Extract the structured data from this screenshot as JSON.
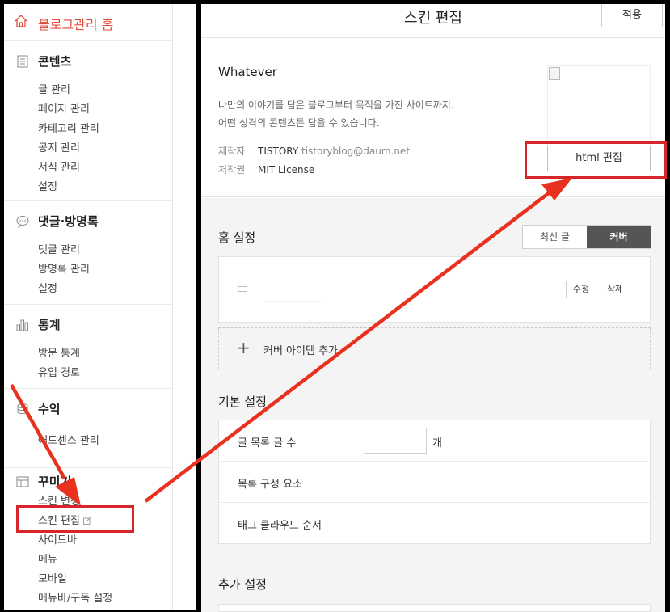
{
  "sidebar": {
    "home": "블로그관리 홈",
    "sections": [
      {
        "title": "콘텐츠",
        "icon": "document-icon",
        "items": [
          "글 관리",
          "페이지 관리",
          "카테고리 관리",
          "공지 관리",
          "서식 관리",
          "설정"
        ]
      },
      {
        "title": "댓글·방명록",
        "icon": "speech-bubble-icon",
        "items": [
          "댓글 관리",
          "방명록 관리",
          "설정"
        ]
      },
      {
        "title": "통계",
        "icon": "bar-chart-icon",
        "items": [
          "방문 통계",
          "유입 경로"
        ]
      },
      {
        "title": "수익",
        "icon": "coins-icon",
        "items": [
          "애드센스 관리"
        ]
      },
      {
        "title": "꾸미기",
        "icon": "layout-icon",
        "items": [
          "스킨 변경",
          "스킨 편집",
          "사이드바",
          "메뉴",
          "모바일",
          "메뉴바/구독 설정"
        ]
      }
    ]
  },
  "editor": {
    "title": "스킨 편집",
    "apply": "적용",
    "skin": {
      "name": "Whatever",
      "desc1": "나만의 이야기를 담은 블로그부터 목적을 가진 사이트까지.",
      "desc2": "어떤 성격의 콘텐츠든 담을 수 있습니다.",
      "author_label": "제작자",
      "author": "TISTORY",
      "email": "tistoryblog@daum.net",
      "license_label": "저작권",
      "license": "MIT License",
      "html_edit": "html 편집"
    },
    "home_settings": {
      "title": "홈 설정",
      "toggle": [
        "최신 글",
        "커버"
      ],
      "edit": "수정",
      "delete": "삭제",
      "add_cover": "커버 아이템 추가"
    },
    "basic_settings": {
      "title": "기본 설정",
      "rows": [
        "글 목록 글 수",
        "목록 구성 요소",
        "태그 클라우드 순서"
      ],
      "unit": "개"
    },
    "extra_settings": {
      "title": "추가 설정"
    }
  },
  "colors": {
    "accent": "#e24d3b",
    "annotation": "#d7262b",
    "toggle_active": "#555555"
  }
}
